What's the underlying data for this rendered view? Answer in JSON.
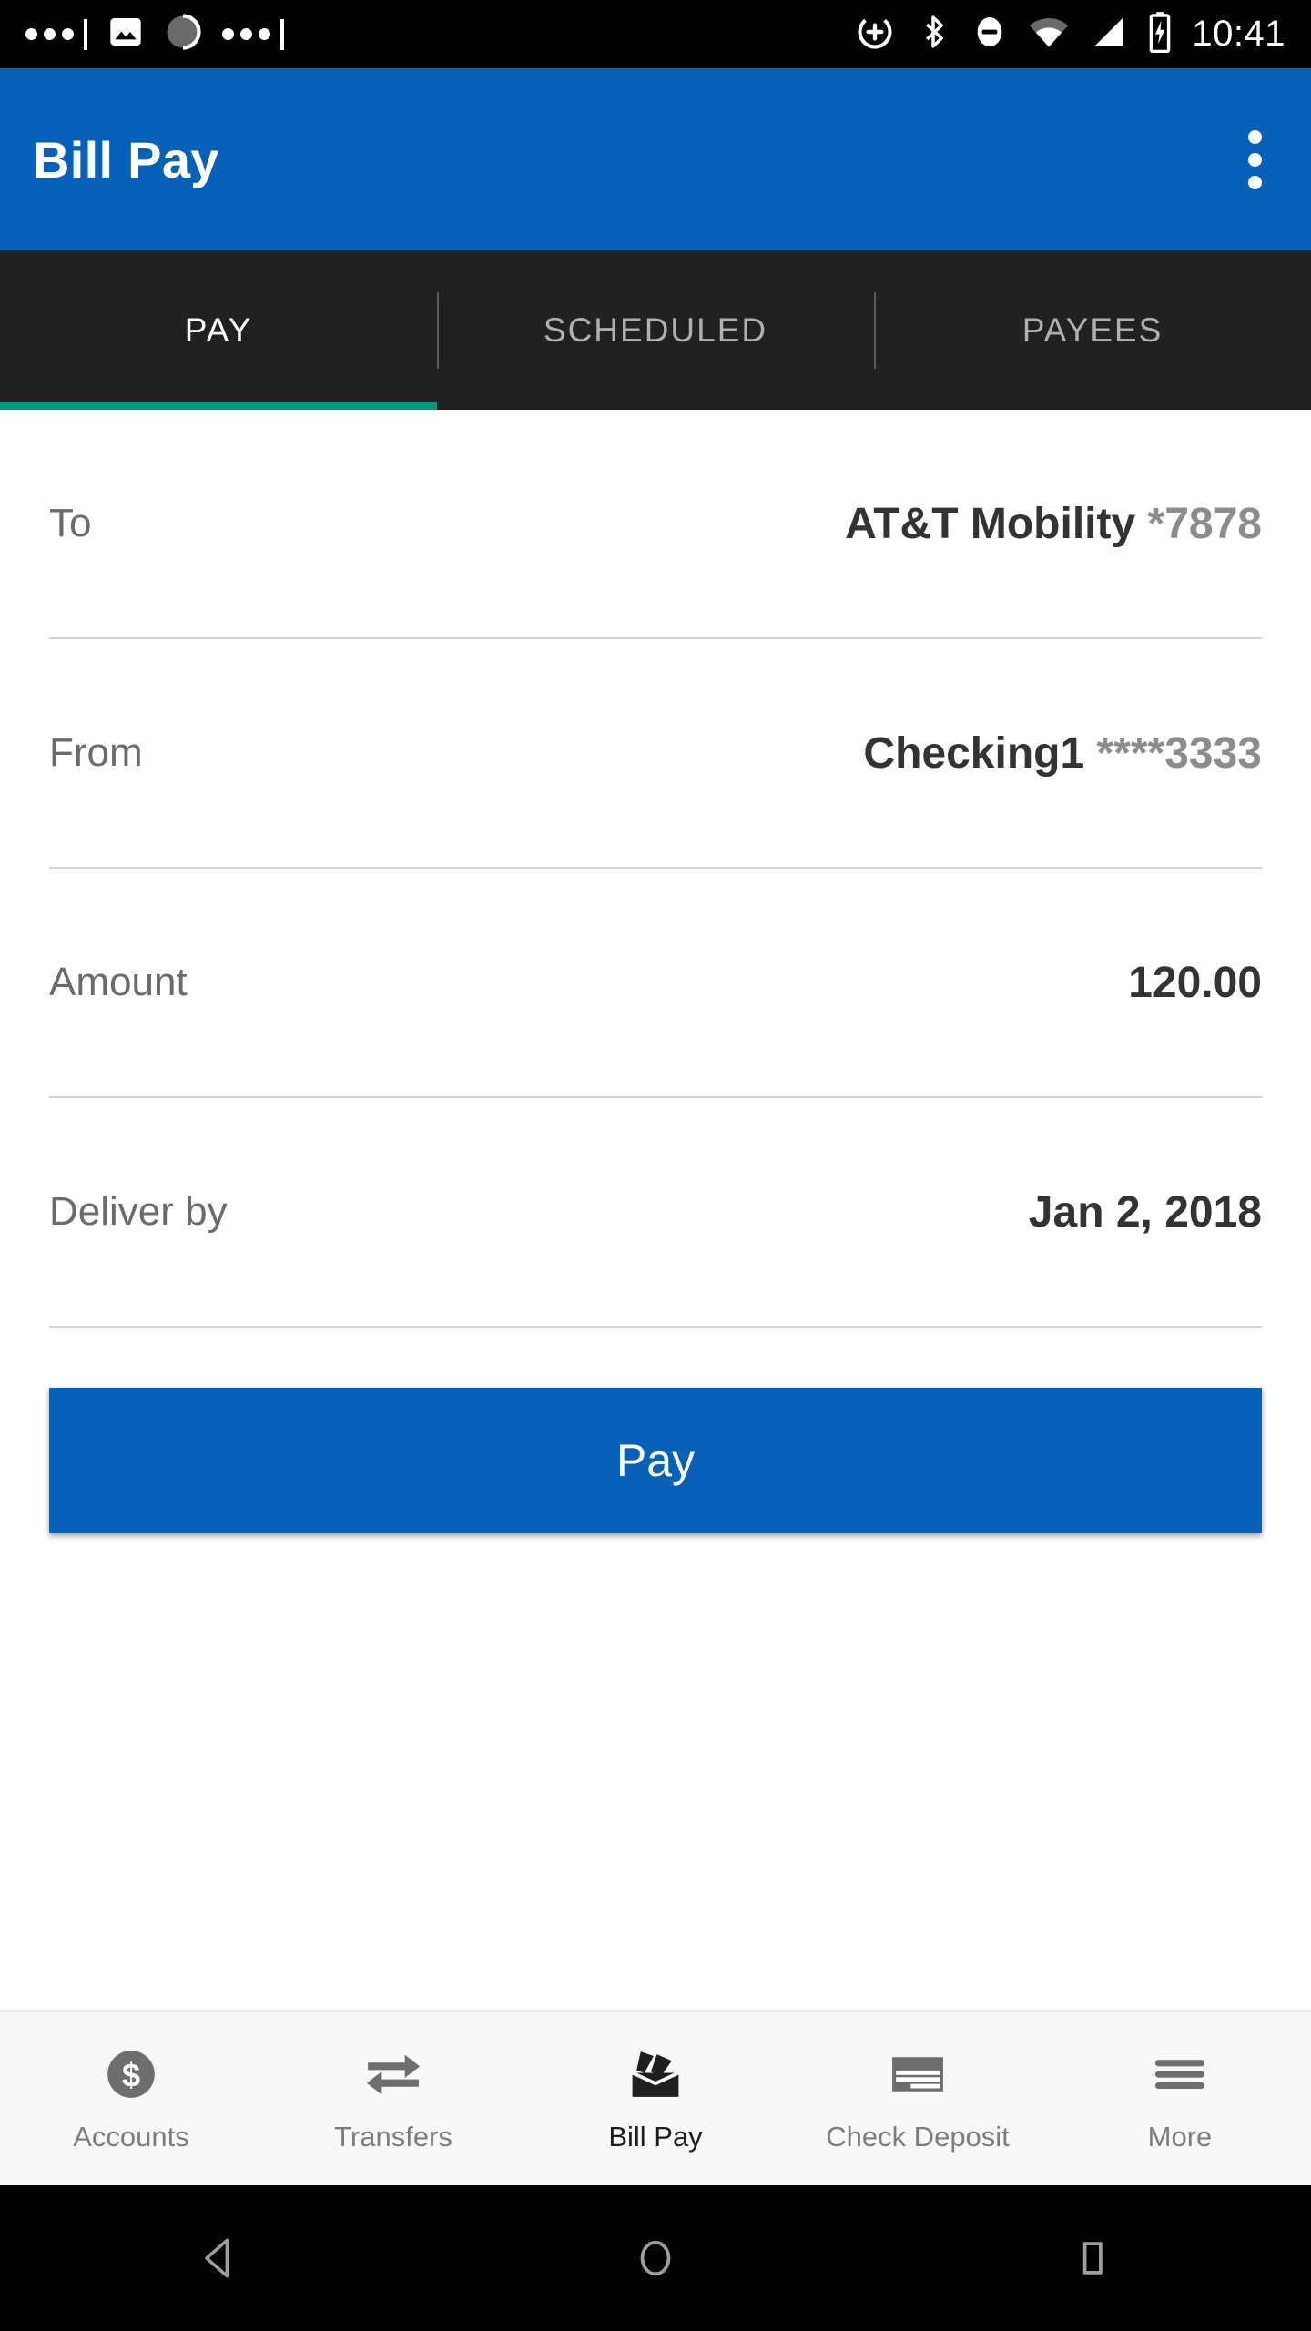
{
  "status_bar": {
    "time": "10:41",
    "left_icons": [
      "more-dots-icon",
      "image-icon",
      "spinner-icon",
      "more-dots-icon"
    ],
    "right_icons": [
      "add-alarm-icon",
      "bluetooth-icon",
      "do-not-disturb-icon",
      "wifi-icon",
      "cellular-signal-icon",
      "battery-charging-icon"
    ]
  },
  "app_bar": {
    "title": "Bill Pay",
    "overflow_menu": "more-vertical-icon"
  },
  "tabs": [
    {
      "label": "PAY",
      "active": true
    },
    {
      "label": "SCHEDULED",
      "active": false
    },
    {
      "label": "PAYEES",
      "active": false
    }
  ],
  "form": {
    "rows": [
      {
        "label": "To",
        "value": "AT&T Mobility",
        "suffix": "*7878"
      },
      {
        "label": "From",
        "value": "Checking1",
        "suffix": "****3333"
      },
      {
        "label": "Amount",
        "value": "120.00",
        "suffix": ""
      },
      {
        "label": "Deliver by",
        "value": "Jan 2, 2018",
        "suffix": ""
      }
    ],
    "submit_label": "Pay"
  },
  "bottom_nav": [
    {
      "label": "Accounts",
      "icon": "dollar-circle-icon",
      "active": false
    },
    {
      "label": "Transfers",
      "icon": "transfer-arrows-icon",
      "active": false
    },
    {
      "label": "Bill Pay",
      "icon": "bill-tray-icon",
      "active": true
    },
    {
      "label": "Check Deposit",
      "icon": "check-icon",
      "active": false
    },
    {
      "label": "More",
      "icon": "hamburger-icon",
      "active": false
    }
  ],
  "android_nav": {
    "back": "back-triangle-icon",
    "home": "home-circle-icon",
    "recents": "recents-square-icon"
  },
  "colors": {
    "primary": "#0761b8",
    "tab_bar": "#212121",
    "accent": "#009688"
  }
}
